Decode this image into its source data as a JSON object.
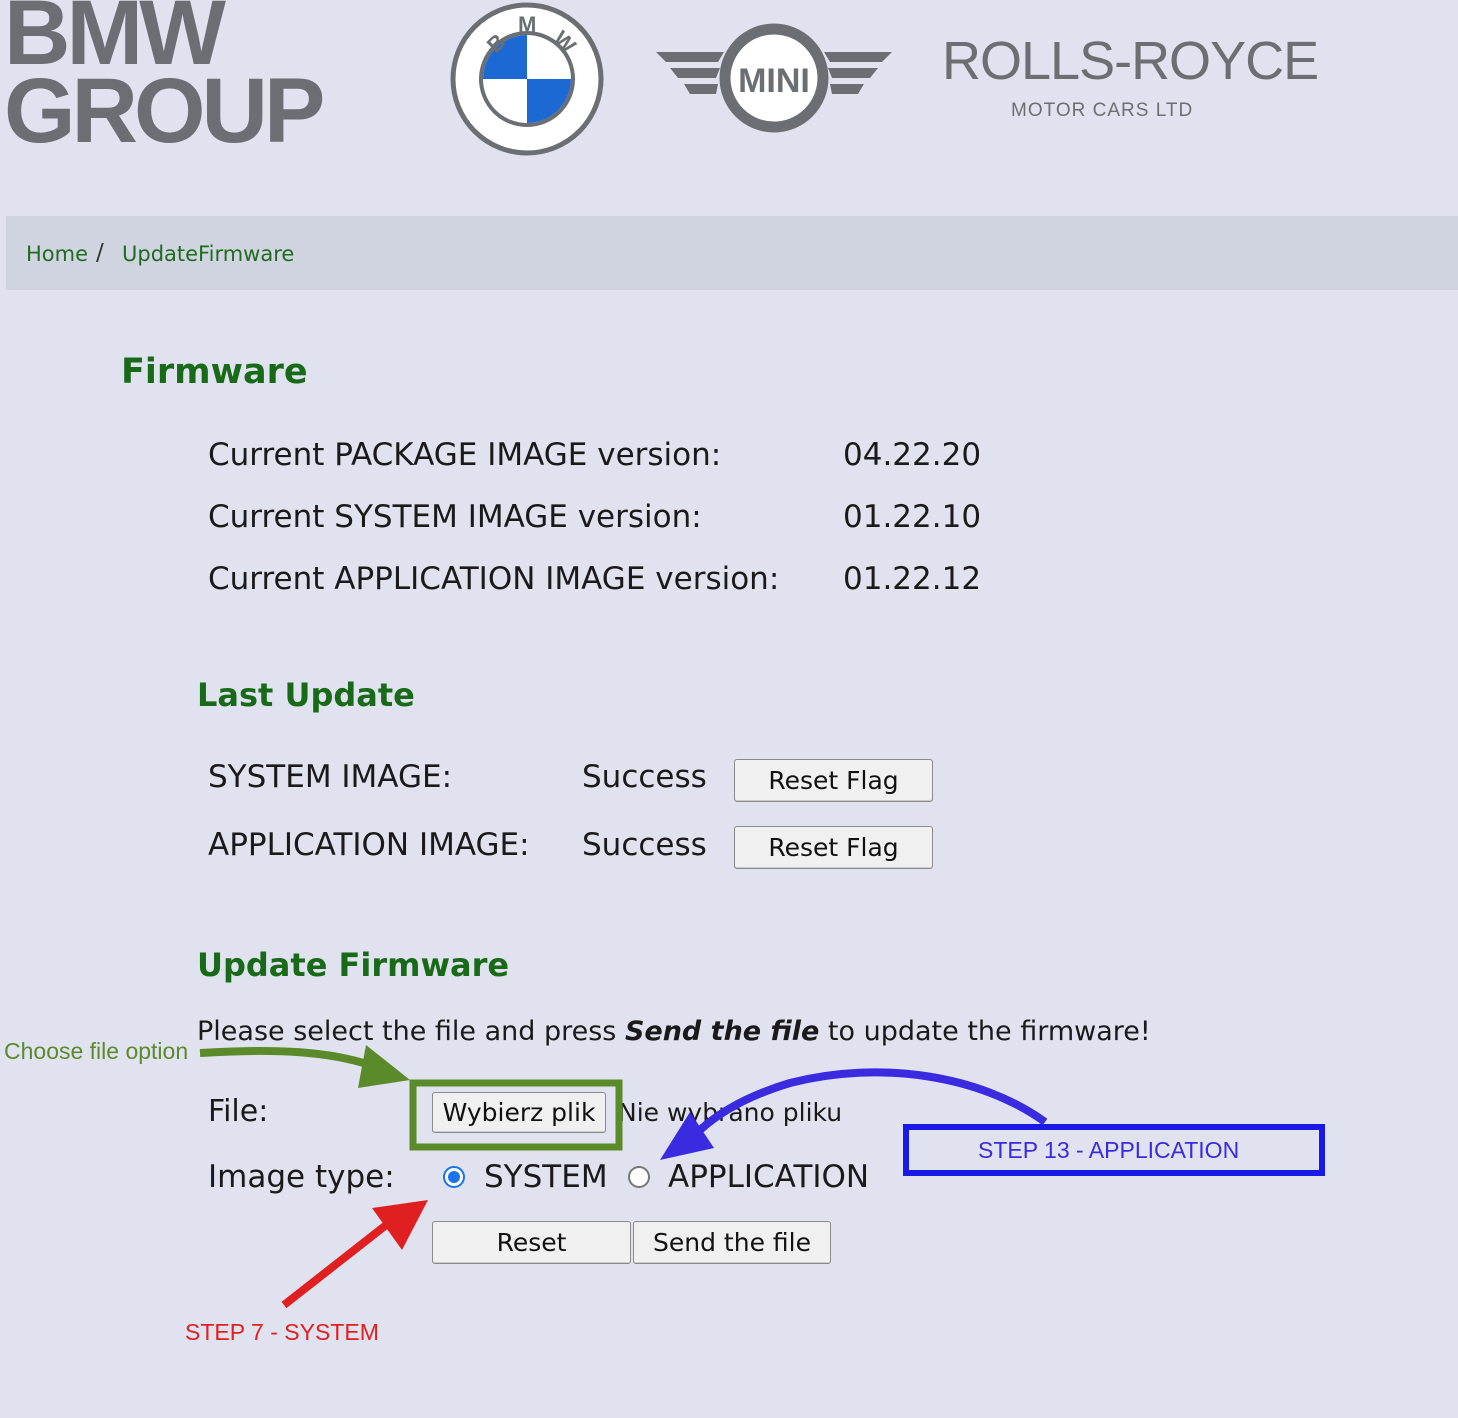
{
  "header": {
    "group_logo": {
      "line1": "BMW",
      "line2": "GROUP"
    },
    "bmw_roundel_letters": "BMW",
    "mini_logo_text": "MINI",
    "rolls_royce": {
      "title": "ROLLS-ROYCE",
      "subtitle": "MOTOR CARS LTD"
    }
  },
  "breadcrumb": {
    "home": "Home",
    "separator": "/",
    "current": "UpdateFirmware"
  },
  "firmware": {
    "title": "Firmware",
    "rows": [
      {
        "label": "Current PACKAGE IMAGE version:",
        "value": "04.22.20"
      },
      {
        "label": "Current SYSTEM IMAGE version:",
        "value": "01.22.10"
      },
      {
        "label": "Current APPLICATION IMAGE version:",
        "value": "01.22.12"
      }
    ]
  },
  "last_update": {
    "title": "Last Update",
    "rows": [
      {
        "label": "SYSTEM IMAGE:",
        "status": "Success",
        "button": "Reset Flag"
      },
      {
        "label": "APPLICATION IMAGE:",
        "status": "Success",
        "button": "Reset Flag"
      }
    ]
  },
  "update_firmware": {
    "title": "Update Firmware",
    "instruction_before": "Please select the file and press ",
    "instruction_emphasis": "Send the file",
    "instruction_after": " to update the firmware!",
    "file_label": "File:",
    "choose_button": "Wybierz plik",
    "no_file_text": "Nie wybrano pliku",
    "image_type_label": "Image type:",
    "options": [
      {
        "label": "SYSTEM",
        "selected": true
      },
      {
        "label": "APPLICATION",
        "selected": false
      }
    ],
    "reset_button": "Reset",
    "send_button": "Send the file"
  },
  "annotations": {
    "choose_file": {
      "text": "Choose file option",
      "color": "#5a8a2a"
    },
    "step13": {
      "text": "STEP 13 - APPLICATION",
      "color": "#3a2ae0",
      "box_color": "#1a1ae8"
    },
    "step7": {
      "text": "STEP 7 - SYSTEM",
      "color": "#e02020"
    }
  },
  "colors": {
    "background": "#e0e3ef",
    "heading_green": "#186a18",
    "logo_gray": "#6b6e72"
  }
}
